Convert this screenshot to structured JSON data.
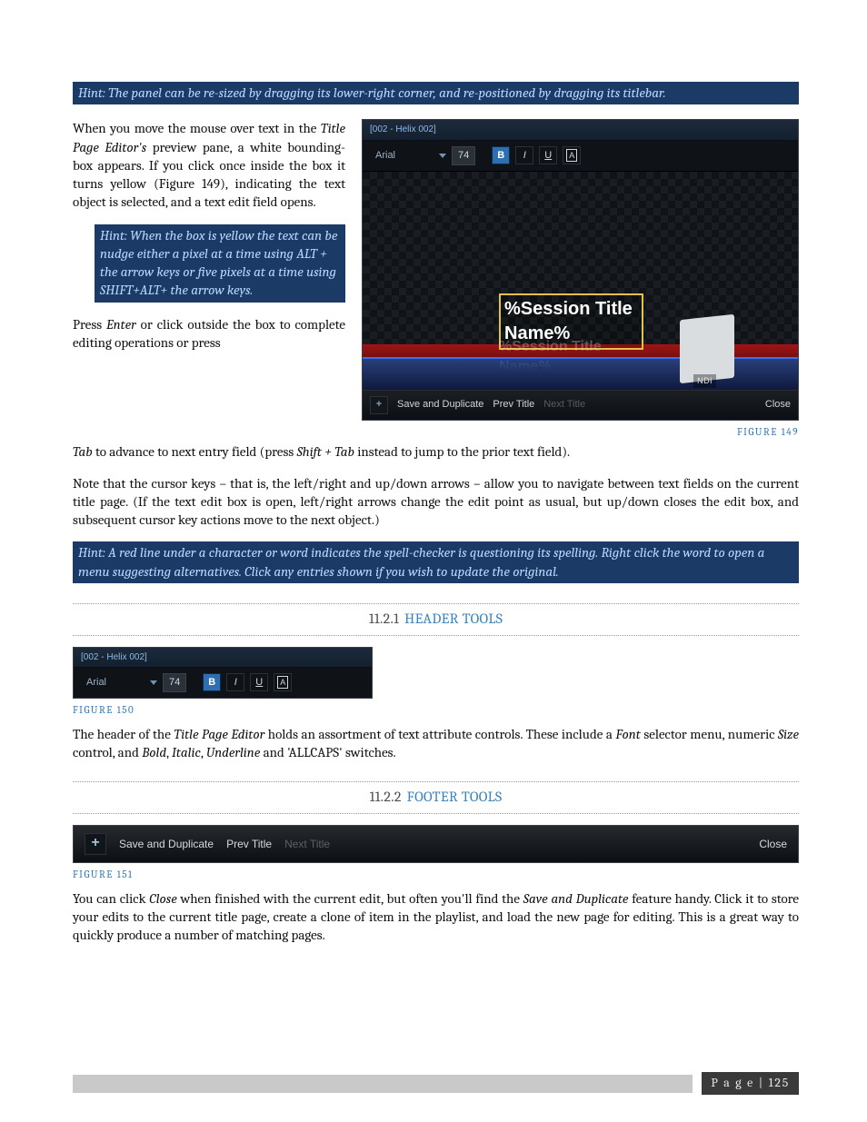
{
  "hints": {
    "resize": "Hint: The panel can be re-sized by dragging its lower-right corner, and re-positioned by dragging its titlebar.",
    "nudge": "Hint: When the box is yellow the text can be nudge either a pixel at a time using ALT + the arrow keys or five pixels at a time using SHIFT+ALT+ the arrow keys.",
    "spell": "Hint: A red line under a character or word indicates the spell-checker is questioning its spelling.  Right click the word to open a menu suggesting alternatives.  Click any entries shown if you wish to update the original."
  },
  "body": {
    "p1_a": "When you move the mouse over text in the ",
    "p1_em1": "Title Page Editor's",
    "p1_b": " preview pane, a white bounding-box appears. If you click once inside the box it turns yellow (Figure 149), indicating the text object is selected, and a text edit field opens.",
    "p2_a": "Press ",
    "p2_em1": "Enter",
    "p2_b": " or click outside the box to complete editing operations or press ",
    "p2_em2": "Tab",
    "p2_c": " to advance to next entry field (press ",
    "p2_em3": "Shift + Tab",
    "p2_d": " instead to jump to the prior text field).",
    "p3": "Note that the cursor keys – that is, the left/right and up/down arrows – allow you to navigate between text fields on the current title page.  (If the text edit box is open, left/right arrows change the edit point as usual, but up/down closes the edit box, and subsequent cursor key actions move to the next object.)",
    "p4_a": "The header of the ",
    "p4_em1": "Title Page Editor",
    "p4_b": " holds an assortment of text attribute controls.  These include a ",
    "p4_em2": "Font",
    "p4_c": " selector menu, numeric ",
    "p4_em3": "Size",
    "p4_d": " control, and ",
    "p4_em4": "Bold",
    "p4_e": ", ",
    "p4_em5": "Italic",
    "p4_f": ", ",
    "p4_em6": "Underline",
    "p4_g": " and 'ALLCAPS' switches.",
    "p5_a": "You can click ",
    "p5_em1": "Close",
    "p5_b": " when finished with the current edit, but often you'll find the ",
    "p5_em2": "Save and Duplicate",
    "p5_c": " feature handy.  Click it to store your edits to the current title page, create a clone of item in the playlist, and load the new page for editing.  This is a great way to quickly produce a number of matching pages."
  },
  "sections": {
    "s1_num": "11.2.1",
    "s1_txt": "HEADER TOOLS",
    "s2_num": "11.2.2",
    "s2_txt": "FOOTER TOOLS"
  },
  "captions": {
    "f149": "FIGURE 149",
    "f150": "FIGURE 150",
    "f151": "FIGURE 151"
  },
  "tpe": {
    "titlebar": "[002 - Helix 002]",
    "font": "Arial",
    "size": "74",
    "bold": "B",
    "italic": "I",
    "underline": "U",
    "allcaps": "A",
    "canvas_text": "%Session Title Name%",
    "canvas_mirror": "%Session Title Name%",
    "ndi": "NDI",
    "footer": {
      "add": "+",
      "save_dup": "Save and Duplicate",
      "prev": "Prev Title",
      "next": "Next Title",
      "close": "Close"
    }
  },
  "footer": {
    "label": "P a g e",
    "sep": " | ",
    "num": "125"
  },
  "chart_data": null
}
